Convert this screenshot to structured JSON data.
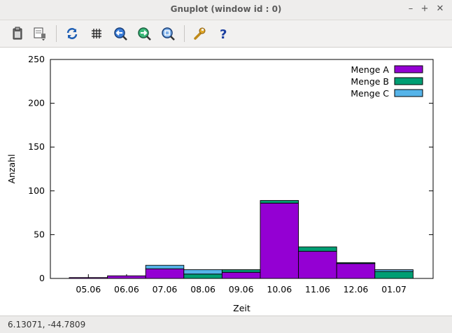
{
  "window": {
    "title": "Gnuplot (window id : 0)",
    "minimize": "–",
    "maximize": "+",
    "close": "✕"
  },
  "toolbar": {
    "icons": [
      "clipboard-icon",
      "print-icon",
      "replot-icon",
      "grid-icon",
      "zoom-prev-icon",
      "zoom-next-icon",
      "zoom-auto-icon",
      "config-icon",
      "help-icon"
    ]
  },
  "status": {
    "text": "6.13071, -44.7809"
  },
  "colors": {
    "menge_a": "#9400d3",
    "menge_b": "#009e73",
    "menge_c": "#56b4e9"
  },
  "chart_data": {
    "type": "bar",
    "stacked": true,
    "categories": [
      "05.06",
      "06.06",
      "07.06",
      "08.06",
      "09.06",
      "10.06",
      "11.06",
      "12.06",
      "01.07"
    ],
    "series": [
      {
        "name": "Menge A",
        "values": [
          1,
          3,
          11,
          0,
          7,
          86,
          31,
          17,
          0
        ]
      },
      {
        "name": "Menge B",
        "values": [
          0,
          0,
          0,
          5,
          3,
          3,
          5,
          1,
          8
        ]
      },
      {
        "name": "Menge C",
        "values": [
          0,
          0,
          4,
          5,
          0,
          0,
          0,
          0,
          2
        ]
      }
    ],
    "xlabel": "Zeit",
    "ylabel": "Anzahl",
    "ylim": [
      0,
      250
    ],
    "yticks": [
      0,
      50,
      100,
      150,
      200,
      250
    ],
    "grid": false,
    "legend": "top-right"
  }
}
